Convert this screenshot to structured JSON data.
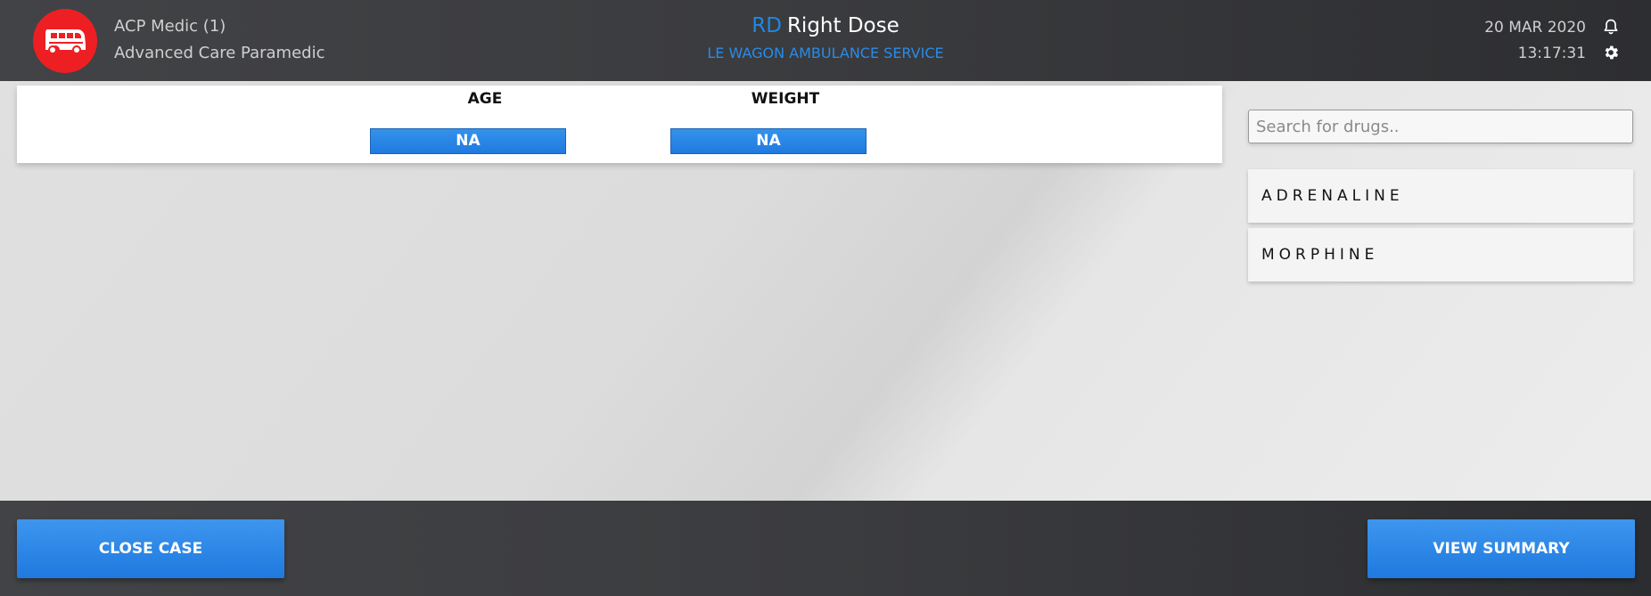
{
  "header": {
    "logo_icon": "ambulance-bus-icon",
    "user_name": "ACP Medic (1)",
    "user_role": "Advanced Care Paramedic",
    "brand_abbr": "RD",
    "brand_name": "Right Dose",
    "service_name": "LE WAGON AMBULANCE SERVICE",
    "date": "20 MAR 2020",
    "time": "13:17:31",
    "bell_icon": "bell-icon",
    "settings_icon": "gear-icon"
  },
  "patient": {
    "age_label": "AGE",
    "age_value": "NA",
    "weight_label": "WEIGHT",
    "weight_value": "NA"
  },
  "drugs": {
    "search_placeholder": "Search for drugs..",
    "items": [
      {
        "label": "ADRENALINE"
      },
      {
        "label": "MORPHINE"
      }
    ]
  },
  "footer": {
    "close_case_label": "CLOSE CASE",
    "view_summary_label": "VIEW SUMMARY"
  },
  "colors": {
    "accent": "#1e88e5",
    "logo_bg": "#ee1f23",
    "bar_bg": "#3a3b3e"
  }
}
